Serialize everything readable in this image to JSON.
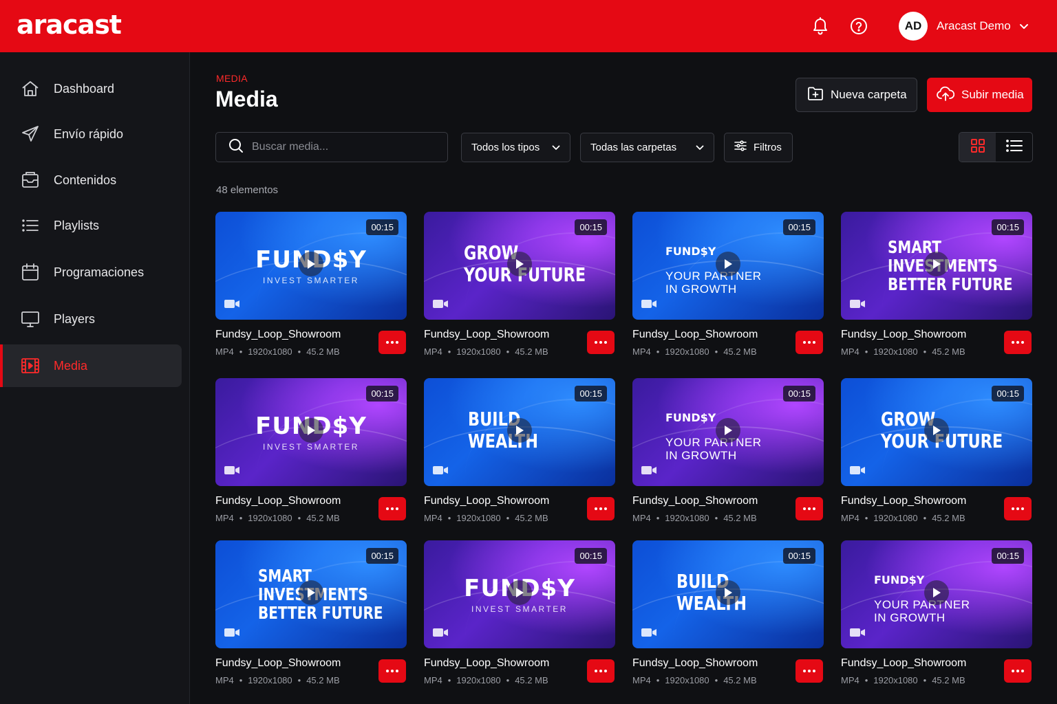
{
  "app": {
    "logo": "aracast",
    "user": {
      "initials": "AD",
      "name": "Aracast Demo"
    }
  },
  "sidebar": {
    "items": [
      {
        "label": "Dashboard",
        "icon": "home-icon"
      },
      {
        "label": "Envío rápido",
        "icon": "send-icon"
      },
      {
        "label": "Contenidos",
        "icon": "inbox-icon"
      },
      {
        "label": "Playlists",
        "icon": "list-icon"
      },
      {
        "label": "Programaciones",
        "icon": "calendar-icon"
      },
      {
        "label": "Players",
        "icon": "monitor-icon"
      },
      {
        "label": "Media",
        "icon": "film-icon",
        "active": true
      }
    ]
  },
  "main": {
    "breadcrumb": "MEDIA",
    "title": "Media",
    "new_folder_label": "Nueva carpeta",
    "upload_label": "Subir media",
    "search_placeholder": "Buscar media...",
    "type_filter": "Todos los tipos",
    "folder_filter": "Todas las carpetas",
    "filters_label": "Filtros",
    "count": "48 elementos"
  },
  "colors": {
    "accent": "#e50914",
    "background": "#0f1013",
    "sidebar": "#141519"
  },
  "cards": [
    {
      "theme": "blue",
      "style": "brand",
      "lines": [
        "FUND$Y",
        "INVEST SMARTER"
      ],
      "duration": "00:15",
      "name": "Fundsy_Loop_Showroom",
      "format": "MP4",
      "resolution": "1920x1080",
      "size": "45.2 MB"
    },
    {
      "theme": "purple",
      "style": "cond",
      "lines": [
        "GROW",
        "YOUR FUTURE"
      ],
      "duration": "00:15",
      "name": "Fundsy_Loop_Showroom",
      "format": "MP4",
      "resolution": "1920x1080",
      "size": "45.2 MB"
    },
    {
      "theme": "blue",
      "style": "tagline",
      "lines": [
        "FUND$Y",
        "YOUR PARTNER",
        "IN GROWTH"
      ],
      "duration": "00:15",
      "name": "Fundsy_Loop_Showroom",
      "format": "MP4",
      "resolution": "1920x1080",
      "size": "45.2 MB"
    },
    {
      "theme": "purple",
      "style": "cond3",
      "lines": [
        "SMART",
        "INVESTMENTS",
        "BETTER FUTURE"
      ],
      "duration": "00:15",
      "name": "Fundsy_Loop_Showroom",
      "format": "MP4",
      "resolution": "1920x1080",
      "size": "45.2 MB"
    },
    {
      "theme": "purple",
      "style": "brand",
      "lines": [
        "FUND$Y",
        "INVEST SMARTER"
      ],
      "duration": "00:15",
      "name": "Fundsy_Loop_Showroom",
      "format": "MP4",
      "resolution": "1920x1080",
      "size": "45.2 MB"
    },
    {
      "theme": "blue",
      "style": "cond",
      "lines": [
        "BUILD",
        "WEALTH"
      ],
      "duration": "00:15",
      "name": "Fundsy_Loop_Showroom",
      "format": "MP4",
      "resolution": "1920x1080",
      "size": "45.2 MB"
    },
    {
      "theme": "purple",
      "style": "tagline",
      "lines": [
        "FUND$Y",
        "YOUR PARTNER",
        "IN GROWTH"
      ],
      "duration": "00:15",
      "name": "Fundsy_Loop_Showroom",
      "format": "MP4",
      "resolution": "1920x1080",
      "size": "45.2 MB"
    },
    {
      "theme": "blue",
      "style": "cond",
      "lines": [
        "GROW",
        "YOUR FUTURE"
      ],
      "duration": "00:15",
      "name": "Fundsy_Loop_Showroom",
      "format": "MP4",
      "resolution": "1920x1080",
      "size": "45.2 MB"
    },
    {
      "theme": "blue",
      "style": "cond3",
      "lines": [
        "SMART",
        "INVESTMENTS",
        "BETTER FUTURE"
      ],
      "duration": "00:15",
      "name": "Fundsy_Loop_Showroom",
      "format": "MP4",
      "resolution": "1920x1080",
      "size": "45.2 MB"
    },
    {
      "theme": "purple",
      "style": "brand",
      "lines": [
        "FUND$Y",
        "INVEST SMARTER"
      ],
      "duration": "00:15",
      "name": "Fundsy_Loop_Showroom",
      "format": "MP4",
      "resolution": "1920x1080",
      "size": "45.2 MB"
    },
    {
      "theme": "blue",
      "style": "cond",
      "lines": [
        "BUILD",
        "WEALTH"
      ],
      "duration": "00:15",
      "name": "Fundsy_Loop_Showroom",
      "format": "MP4",
      "resolution": "1920x1080",
      "size": "45.2 MB"
    },
    {
      "theme": "purple",
      "style": "tagline",
      "lines": [
        "FUND$Y",
        "YOUR PARTNER",
        "IN GROWTH"
      ],
      "duration": "00:15",
      "name": "Fundsy_Loop_Showroom",
      "format": "MP4",
      "resolution": "1920x1080",
      "size": "45.2 MB"
    }
  ]
}
